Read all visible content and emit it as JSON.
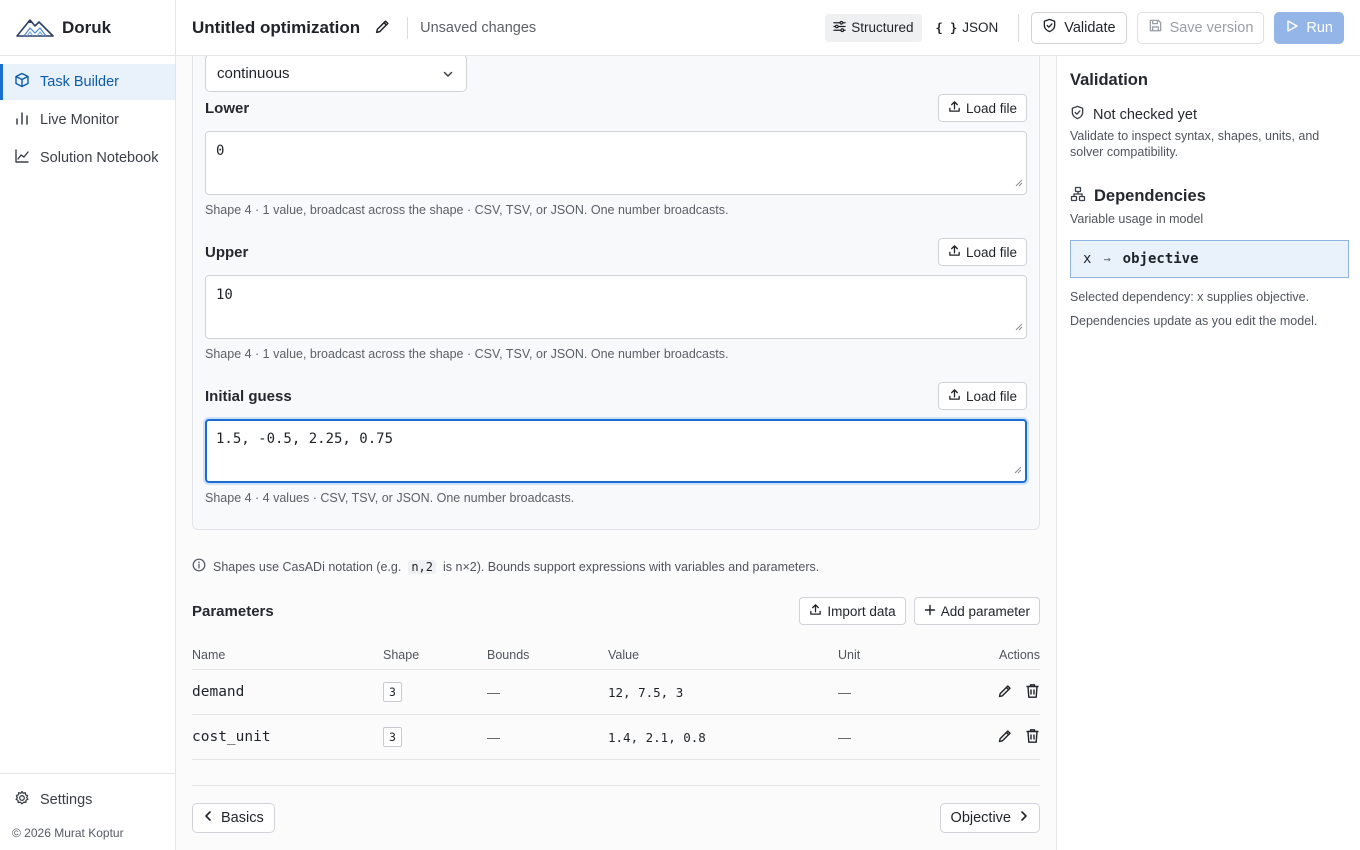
{
  "app": {
    "name": "Doruk"
  },
  "sidebar": {
    "items": [
      {
        "label": "Task Builder",
        "icon": "cube-icon",
        "active": true
      },
      {
        "label": "Live Monitor",
        "icon": "bar-chart-icon"
      },
      {
        "label": "Solution Notebook",
        "icon": "line-chart-icon"
      }
    ],
    "settings_label": "Settings",
    "copyright": "© 2026 Murat Koptur"
  },
  "topbar": {
    "title": "Untitled optimization",
    "status": "Unsaved changes",
    "view_structured": "Structured",
    "view_json": "JSON",
    "json_icon": "{ }",
    "validate_label": "Validate",
    "save_label": "Save version",
    "run_label": "Run"
  },
  "variable": {
    "type_value": "continuous",
    "fields": [
      {
        "label": "Lower",
        "value": "0",
        "load_label": "Load file",
        "hint": "Shape 4 · 1 value, broadcast across the shape · CSV, TSV, or JSON. One number broadcasts."
      },
      {
        "label": "Upper",
        "value": "10",
        "load_label": "Load file",
        "hint": "Shape 4 · 1 value, broadcast across the shape · CSV, TSV, or JSON. One number broadcasts."
      },
      {
        "label": "Initial guess",
        "value": "1.5, -0.5, 2.25, 0.75",
        "load_label": "Load file",
        "hint": "Shape 4 · 4 values · CSV, TSV, or JSON. One number broadcasts."
      }
    ]
  },
  "info": {
    "prefix": "Shapes use CasADi notation (e.g.",
    "code": "n,2",
    "suffix": "is n×2). Bounds support expressions with variables and parameters."
  },
  "parameters": {
    "title": "Parameters",
    "import_label": "Import data",
    "add_label": "Add parameter",
    "columns": [
      "Name",
      "Shape",
      "Bounds",
      "Value",
      "Unit",
      "Actions"
    ],
    "rows": [
      {
        "name": "demand",
        "shape": "3",
        "bounds": "—",
        "value": "12, 7.5, 3",
        "unit": "—"
      },
      {
        "name": "cost_unit",
        "shape": "3",
        "bounds": "—",
        "value": "1.4, 2.1, 0.8",
        "unit": "—"
      }
    ]
  },
  "footer": {
    "prev_label": "Basics",
    "next_label": "Objective"
  },
  "validation": {
    "title": "Validation",
    "status": "Not checked yet",
    "description": "Validate to inspect syntax, shapes, units, and solver compatibility.",
    "dependencies_title": "Dependencies",
    "dependencies_sub": "Variable usage in model",
    "dep_from": "x",
    "dep_arrow": "→",
    "dep_to": "objective",
    "note_selected": "Selected dependency: x supplies objective.",
    "note_update": "Dependencies update as you edit the model."
  },
  "colors": {
    "accent": "#1a6dd1",
    "accent_bg": "#e9f1fb",
    "run_disabled": "#93b5e8"
  }
}
